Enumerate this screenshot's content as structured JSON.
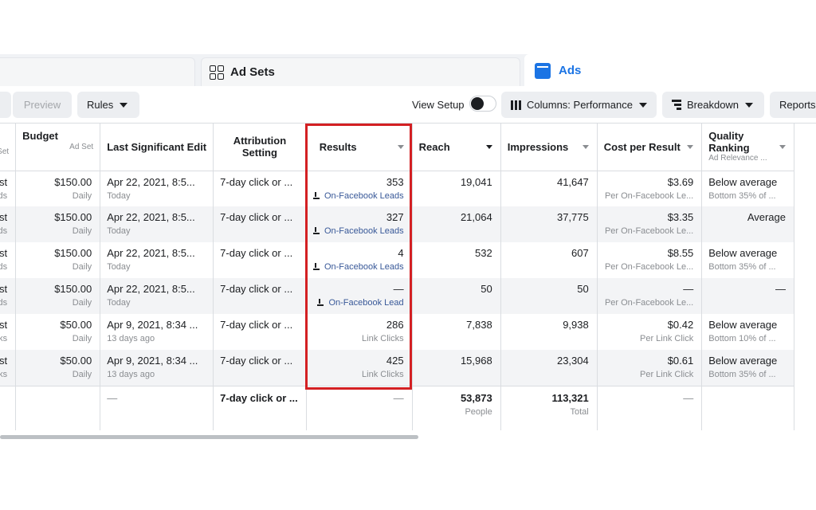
{
  "tabs": {
    "adsets": "Ad Sets",
    "ads": "Ads"
  },
  "toolbar": {
    "preview": "Preview",
    "rules": "Rules",
    "view_setup": "View Setup",
    "columns": "Columns: Performance",
    "breakdown": "Breakdown",
    "reports": "Reports"
  },
  "columns": {
    "first": "Set",
    "budget": "Budget",
    "budget_sub": "Ad Set",
    "last_edit": "Last Significant Edit",
    "attribution": "Attribution Setting",
    "results": "Results",
    "reach": "Reach",
    "impressions": "Impressions",
    "cost_per_result": "Cost per Result",
    "quality": "Quality Ranking",
    "quality_sub": "Ad Relevance ..."
  },
  "rows": [
    {
      "c1a": "ost",
      "c1b": "ds",
      "budget": "$150.00",
      "budget_sub": "Daily",
      "edit": "Apr 22, 2021, 8:5...",
      "edit_sub": "Today",
      "attr": "7-day click or ...",
      "results": "353",
      "results_sub": "On-Facebook Leads",
      "reach": "19,041",
      "impressions": "41,647",
      "cpr": "$3.69",
      "cpr_sub": "Per On-Facebook Le...",
      "quality": "Below average",
      "quality_sub": "Bottom 35% of ..."
    },
    {
      "c1a": "ost",
      "c1b": "ds",
      "budget": "$150.00",
      "budget_sub": "Daily",
      "edit": "Apr 22, 2021, 8:5...",
      "edit_sub": "Today",
      "attr": "7-day click or ...",
      "results": "327",
      "results_sub": "On-Facebook Leads",
      "reach": "21,064",
      "impressions": "37,775",
      "cpr": "$3.35",
      "cpr_sub": "Per On-Facebook Le...",
      "quality": "Average",
      "quality_sub": ""
    },
    {
      "c1a": "ost",
      "c1b": "ds",
      "budget": "$150.00",
      "budget_sub": "Daily",
      "edit": "Apr 22, 2021, 8:5...",
      "edit_sub": "Today",
      "attr": "7-day click or ...",
      "results": "4",
      "results_sub": "On-Facebook Leads",
      "reach": "532",
      "impressions": "607",
      "cpr": "$8.55",
      "cpr_sub": "Per On-Facebook Le...",
      "quality": "Below average",
      "quality_sub": "Bottom 35% of ..."
    },
    {
      "c1a": "ost",
      "c1b": "ds",
      "budget": "$150.00",
      "budget_sub": "Daily",
      "edit": "Apr 22, 2021, 8:5...",
      "edit_sub": "Today",
      "attr": "7-day click or ...",
      "results": "—",
      "results_sub": "On-Facebook Lead",
      "reach": "50",
      "impressions": "50",
      "cpr": "—",
      "cpr_sub": "Per On-Facebook Le...",
      "quality": "—",
      "quality_sub": ""
    },
    {
      "c1a": "ost",
      "c1b": "cks",
      "budget": "$50.00",
      "budget_sub": "Daily",
      "edit": "Apr 9, 2021, 8:34 ...",
      "edit_sub": "13 days ago",
      "attr": "7-day click or ...",
      "results": "286",
      "results_sub": "Link Clicks",
      "reach": "7,838",
      "impressions": "9,938",
      "cpr": "$0.42",
      "cpr_sub": "Per Link Click",
      "quality": "Below average",
      "quality_sub": "Bottom 10% of ..."
    },
    {
      "c1a": "ost",
      "c1b": "cks",
      "budget": "$50.00",
      "budget_sub": "Daily",
      "edit": "Apr 9, 2021, 8:34 ...",
      "edit_sub": "13 days ago",
      "attr": "7-day click or ...",
      "results": "425",
      "results_sub": "Link Clicks",
      "reach": "15,968",
      "impressions": "23,304",
      "cpr": "$0.61",
      "cpr_sub": "Per Link Click",
      "quality": "Below average",
      "quality_sub": "Bottom 35% of ..."
    }
  ],
  "totals": {
    "edit": "—",
    "attr": "7-day click or ...",
    "results": "—",
    "reach": "53,873",
    "reach_sub": "People",
    "impressions": "113,321",
    "impressions_sub": "Total",
    "cpr": "—"
  },
  "colors": {
    "accent": "#1b74e4",
    "highlight": "#d32023",
    "link": "#385898"
  },
  "icons": {
    "adsets_tab": "grid-icon",
    "ads_tab": "ads-square-icon",
    "lead": "download-icon"
  }
}
